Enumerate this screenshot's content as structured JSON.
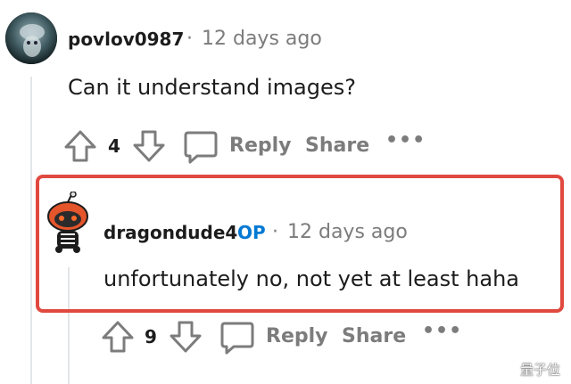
{
  "comment1": {
    "username": "povlov0987",
    "separator": "·",
    "time": "12 days ago",
    "body": "Can it understand images?",
    "vote_count": "4",
    "reply_label": "Reply",
    "share_label": "Share",
    "more_label": "•••"
  },
  "comment2": {
    "username": "dragondude4",
    "op_badge": "OP",
    "separator": "·",
    "time": "12 days ago",
    "body": "unfortunately no, not yet at least haha",
    "vote_count": "9",
    "reply_label": "Reply",
    "share_label": "Share",
    "more_label": "•••"
  },
  "watermark": {
    "text": "量子位"
  },
  "colors": {
    "highlight": "#e0493f",
    "op": "#0079d3",
    "muted": "#7c7c7c",
    "thread_line": "#e3e6e8"
  }
}
